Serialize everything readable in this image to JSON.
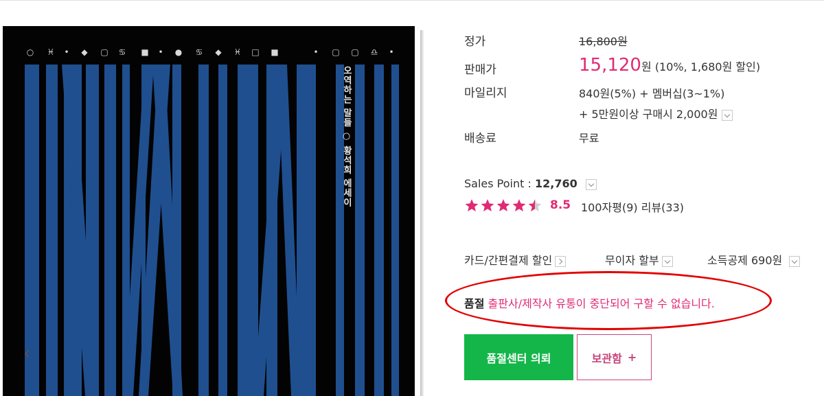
{
  "cover": {
    "title_vertical": "오역하는 말들 ○ 황석희 에세이",
    "symbols": [
      "○",
      "♓",
      "•",
      "◆",
      "▢",
      "♋",
      "■",
      "•",
      "●",
      "♋",
      "◆",
      "♓",
      "□",
      "■",
      "•",
      "▢",
      "▢",
      "♎",
      "•"
    ],
    "bar_color": "#1f4f8f",
    "nav_prev": "‹"
  },
  "price": {
    "list_label": "정가",
    "list_value": "16,800원",
    "sale_label": "판매가",
    "sale_value": "15,120",
    "sale_unit": "원",
    "sale_discount": "(10%, 1,680원 할인)",
    "mileage_label": "마일리지",
    "mileage_line1": "840원(5%) + 멤버십(3~1%)",
    "mileage_line2": "+ 5만원이상 구매시 2,000원",
    "shipping_label": "배송료",
    "shipping_value": "무료"
  },
  "sales": {
    "label": "Sales Point : ",
    "value": "12,760",
    "rating": "8.5",
    "stars": 4.5,
    "reviews": "100자평(9)  리뷰(33)"
  },
  "options": {
    "card": "카드/간편결제 할인",
    "installment": "무이자 할부",
    "tax": "소득공제 690원"
  },
  "status": {
    "soldout_label": "품절",
    "soldout_message": "출판사/제작사 유통이 중단되어 구할 수 없습니다."
  },
  "buttons": {
    "request": "품절센터 의뢰",
    "keep": "보관함",
    "keep_plus": "+"
  },
  "colors": {
    "accent_pink": "#e12a73",
    "green": "#14b64a",
    "highlight_red": "#e30000"
  }
}
